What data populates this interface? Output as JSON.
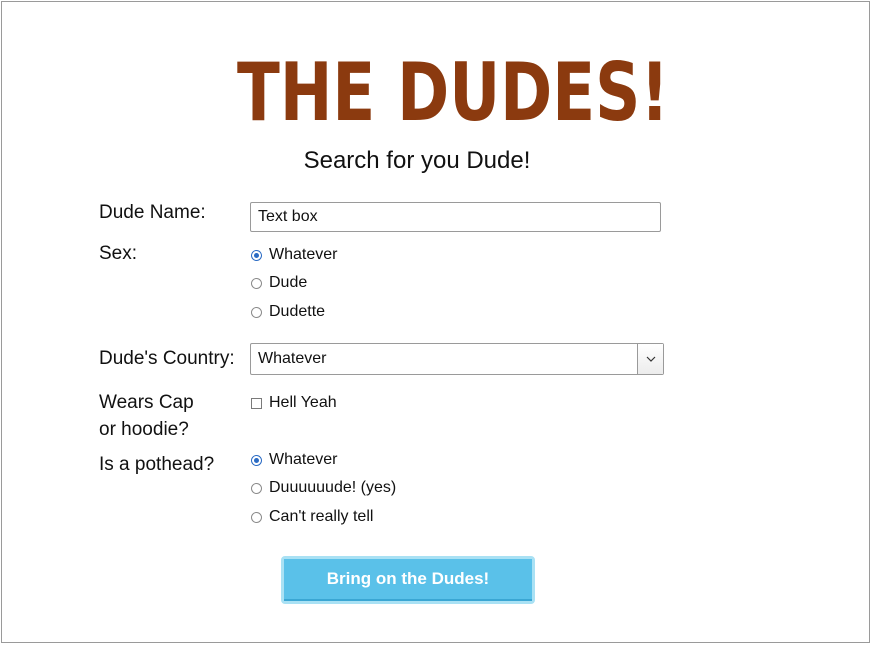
{
  "header": {
    "logo_text": "THE DUDES!",
    "logo_color": "#8b3a0f",
    "subtitle": "Search for you Dude!"
  },
  "form": {
    "name": {
      "label": "Dude Name:",
      "value": "Text box"
    },
    "sex": {
      "label": "Sex:",
      "options": [
        "Whatever",
        "Dude",
        "Dudette"
      ],
      "selected": "Whatever"
    },
    "country": {
      "label": "Dude's Country:",
      "selected": "Whatever"
    },
    "cap": {
      "label_line1": "Wears Cap",
      "label_line2": "or hoodie?",
      "option": "Hell Yeah",
      "checked": false
    },
    "pothead": {
      "label": "Is a pothead?",
      "options": [
        "Whatever",
        "Duuuuuude! (yes)",
        "Can't really tell"
      ],
      "selected": "Whatever"
    },
    "submit_label": "Bring on the Dudes!",
    "submit_color": "#5ac1e9"
  }
}
